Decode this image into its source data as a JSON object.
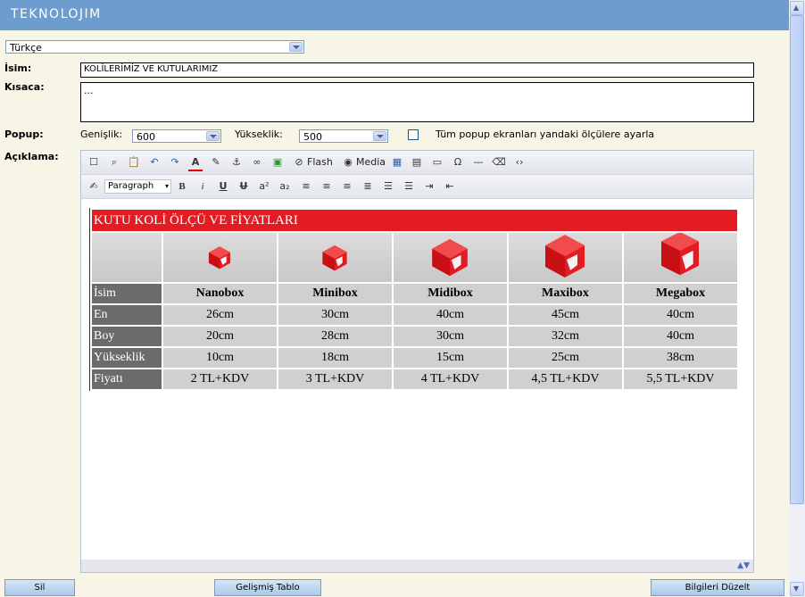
{
  "app": {
    "logo": "TEKNOLOJIM"
  },
  "language": {
    "selected": "Türkçe"
  },
  "form": {
    "isim_label": "İsim:",
    "isim_value": "KOLİLERİMİZ VE KUTULARIMIZ",
    "kisaca_label": "Kısaca:",
    "kisaca_value": "...",
    "popup_label": "Popup:",
    "genislik_label": "Genişlik:",
    "genislik_value": "600",
    "yukseklik_label": "Yükseklik:",
    "yukseklik_value": "500",
    "all_popup_label": "Tüm popup ekranları yandaki ölçülere ayarla",
    "aciklama_label": "Açıklama:"
  },
  "toolbar": {
    "flash_label": "Flash",
    "media_label": "Media",
    "format_select": "Paragraph"
  },
  "table": {
    "title": "KUTU KOLİ ÖLÇÜ VE FİYATLARI",
    "row_headers": [
      "İsim",
      "En",
      "Boy",
      "Yükseklik",
      "Fiyatı"
    ],
    "products": [
      {
        "name": "Nanobox",
        "en": "26cm",
        "boy": "20cm",
        "yukseklik": "10cm",
        "fiyat": "2 TL+KDV"
      },
      {
        "name": "Minibox",
        "en": "30cm",
        "boy": "28cm",
        "yukseklik": "18cm",
        "fiyat": "3 TL+KDV"
      },
      {
        "name": "Midibox",
        "en": "40cm",
        "boy": "30cm",
        "yukseklik": "15cm",
        "fiyat": "4 TL+KDV"
      },
      {
        "name": "Maxibox",
        "en": "45cm",
        "boy": "32cm",
        "yukseklik": "25cm",
        "fiyat": "4,5 TL+KDV"
      },
      {
        "name": "Megabox",
        "en": "40cm",
        "boy": "40cm",
        "yukseklik": "38cm",
        "fiyat": "5,5 TL+KDV"
      }
    ]
  },
  "buttons": {
    "sil": "Sil",
    "gelismis": "Gelişmiş Tablo",
    "duzelt": "Bilgileri Düzelt"
  },
  "colors": {
    "header": "#6d9ccf",
    "table_title": "#e31b23",
    "background": "#f6f5e6"
  }
}
